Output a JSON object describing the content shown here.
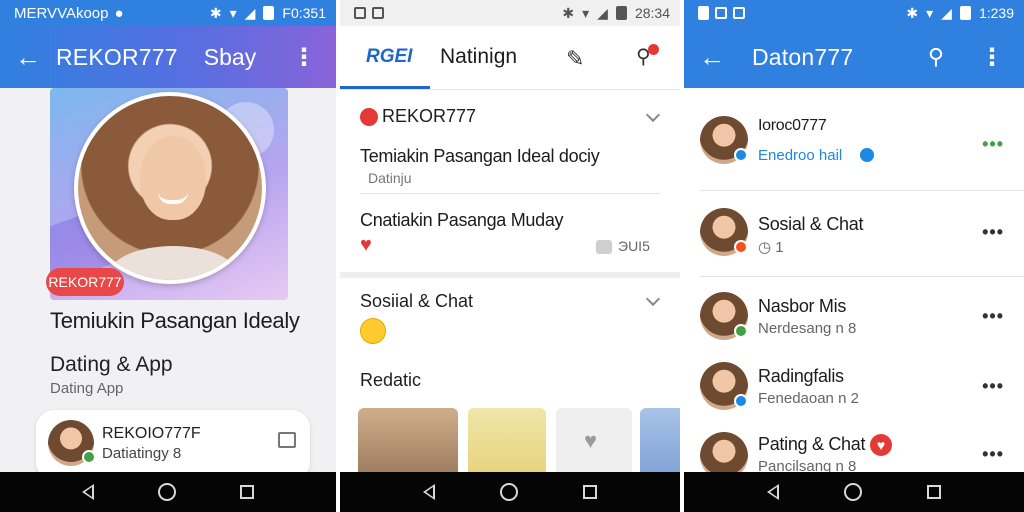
{
  "panel1": {
    "status": {
      "left": "MERVVAkoop",
      "right": "F0:351"
    },
    "appbar": {
      "title": "REKOR777",
      "sub": "Sbay"
    },
    "badge": "REKOR777",
    "profile_title": "Temiukin Pasangan Idealy",
    "category": "Dating & App",
    "category_sub": "Dating App",
    "card": {
      "name": "REKOIO777F",
      "sub": "Datiatingy 8"
    }
  },
  "panel2": {
    "status": {
      "time": "28:34"
    },
    "tabs": {
      "logo": "RGEI",
      "title": "Natinign"
    },
    "section1": {
      "header": "REKOR777",
      "item1_title": "Temiakin Pasangan Ideal dociy",
      "item1_sub": "Datinju",
      "item2_title": "Cnatiakin Pasanga Muday",
      "item2_meta": "ЭUI5"
    },
    "section2": {
      "header": "Sosiial & Chat",
      "sub_header": "Redatic"
    }
  },
  "panel3": {
    "status": {
      "time": "1:239"
    },
    "appbar": {
      "title": "Daton777"
    },
    "items": [
      {
        "name": "Ioroc0777",
        "sub": "Enedroo hail"
      },
      {
        "name": "Sosial & Chat",
        "sub": "1"
      },
      {
        "name": "Nasbor Mis",
        "sub": "Nerdesang n 8"
      },
      {
        "name": "Radingfalis",
        "sub": "Fenedaoan n 2"
      },
      {
        "name": "Pating & Chat",
        "sub": "Pancilsang n 8"
      }
    ]
  },
  "colors": {
    "primary": "#2f80df",
    "accent_red": "#e53935",
    "online_green": "#43a047",
    "verified_blue": "#1e88e5"
  },
  "icons": [
    "back-arrow-icon",
    "more-vert-icon",
    "search-icon",
    "pencil-icon",
    "notification-icon",
    "chevron-down-icon",
    "heart-icon",
    "nav-back-icon",
    "nav-home-icon",
    "nav-recents-icon"
  ]
}
